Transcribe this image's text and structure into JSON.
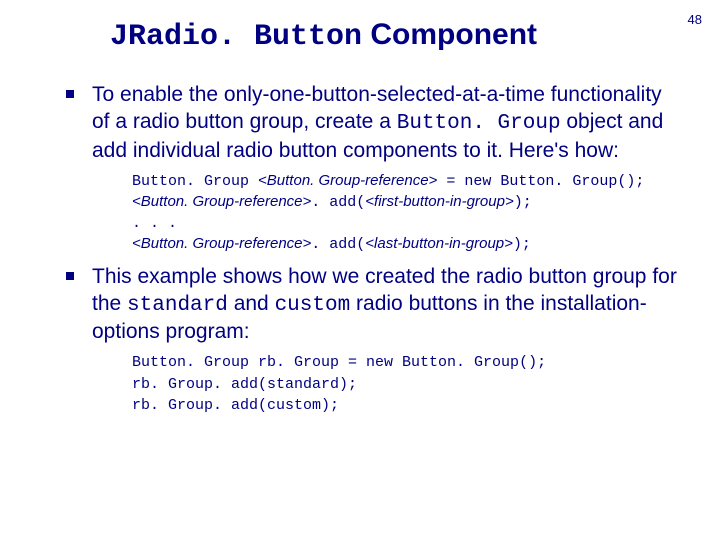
{
  "page_number": "48",
  "title": {
    "code": "JRadio. Button",
    "rest": " Component"
  },
  "items": [
    {
      "para_html": "To enable the only-one-button-selected-at-a-time functionality of a radio button group, create a <span class=\"mono\">Button. Group</span> object and add individual radio button components to it. Here's how:",
      "code_html": "<span class=\"mono\">Button. Group </span><span class=\"ital\">&lt;Button. Group-reference&gt;</span><span class=\"mono\"> = new Button. Group();</span><br><span class=\"ital\">&lt;Button. Group-reference&gt;</span><span class=\"mono\">. add(</span><span class=\"ital\">&lt;first-button-in-group&gt;</span><span class=\"mono\">);</span><br><span class=\"mono\">. . .</span><br><span class=\"ital\">&lt;Button. Group-reference&gt;</span><span class=\"mono\">. add(</span><span class=\"ital\">&lt;last-button-in-group&gt;</span><span class=\"mono\">);</span>"
    },
    {
      "para_html": "This example shows how we created the radio button group for the <span class=\"mono\">standard</span> and <span class=\"mono\">custom</span> radio buttons in the installation-options program:",
      "code_html": "<span class=\"mono\">Button. Group rb. Group = new Button. Group();<br>rb. Group. add(standard);<br>rb. Group. add(custom);</span>"
    }
  ]
}
